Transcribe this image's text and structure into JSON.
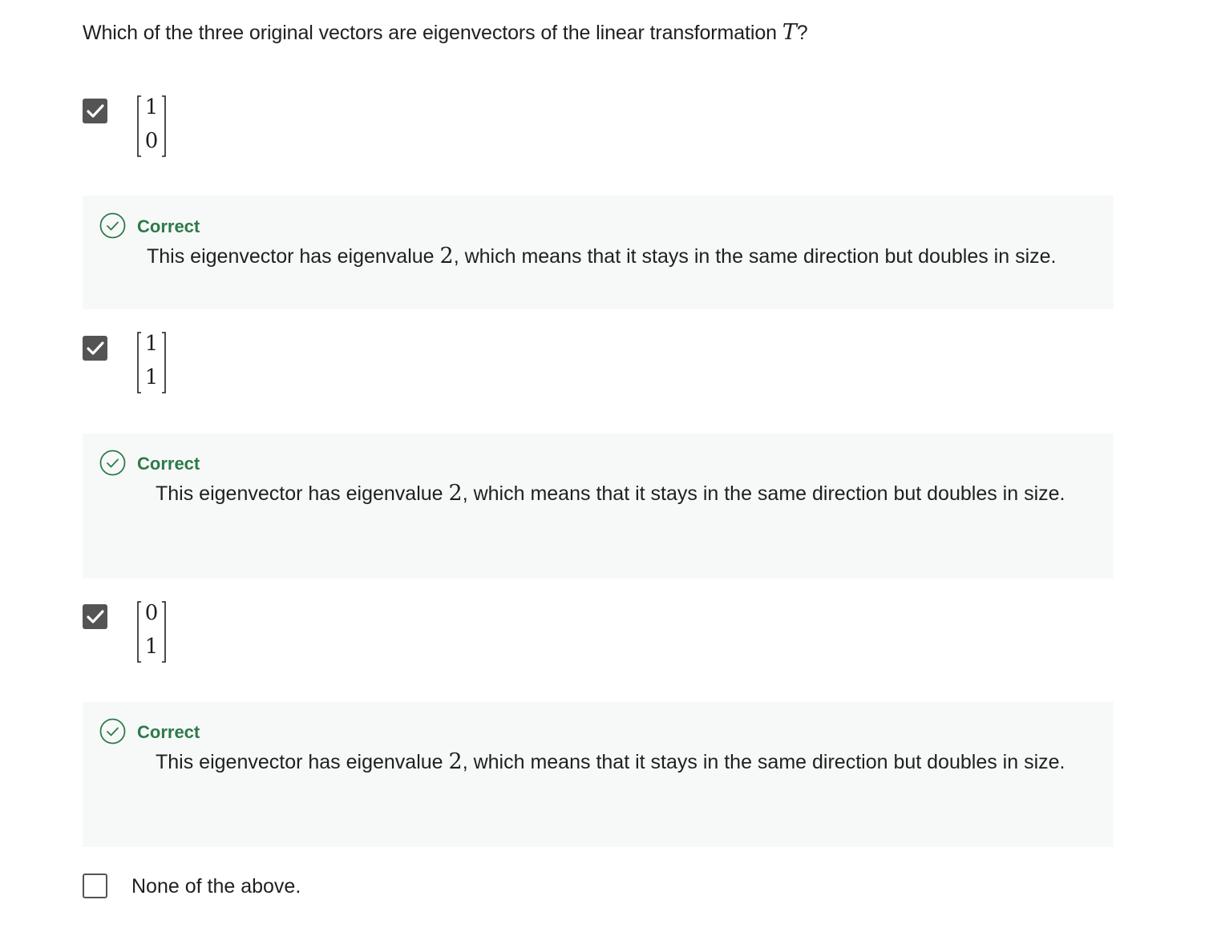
{
  "question": {
    "text": "Which of the three original vectors are eigenvectors of the linear transformation ",
    "variable": "T",
    "end": "?"
  },
  "options": [
    {
      "checked": true,
      "vector": [
        "1",
        "0"
      ],
      "feedback": {
        "status": "Correct",
        "text_before": "This eigenvector has eigenvalue ",
        "number": "2",
        "text_after": ", which means that it stays in the same direction but doubles in size."
      }
    },
    {
      "checked": true,
      "vector": [
        "1",
        "1"
      ],
      "feedback": {
        "status": "Correct",
        "text_before": "This eigenvector has eigenvalue ",
        "number": "2",
        "text_after": ", which means that it stays in the same direction but doubles in size."
      }
    },
    {
      "checked": true,
      "vector": [
        "0",
        "1"
      ],
      "feedback": {
        "status": "Correct",
        "text_before": "This eigenvector has eigenvalue ",
        "number": "2",
        "text_after": ", which means that it stays in the same direction but doubles in size."
      }
    },
    {
      "checked": false,
      "label": "None of the above."
    }
  ],
  "colors": {
    "correct_green": "#2d7a4a",
    "feedback_bg": "#f7f9f8",
    "checkbox_gray": "#545454"
  }
}
